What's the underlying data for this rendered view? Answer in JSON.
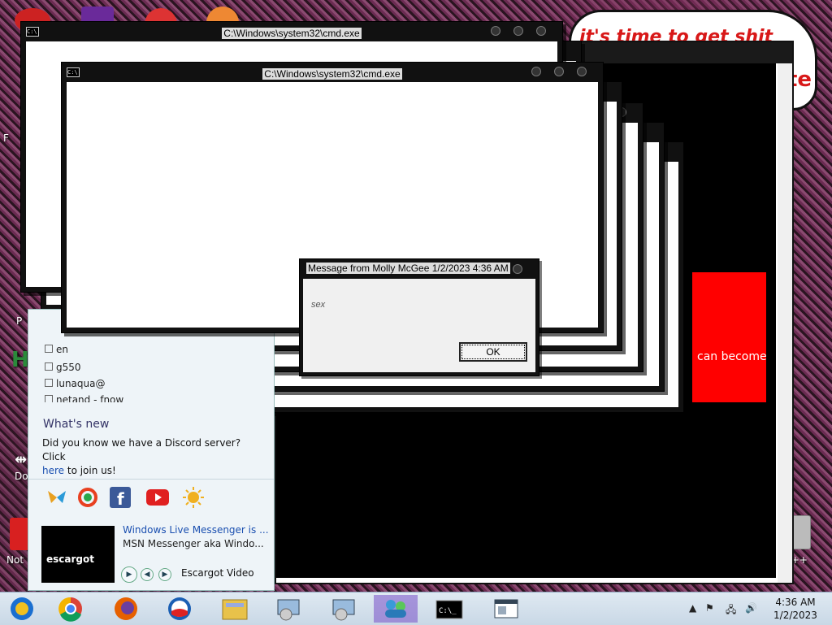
{
  "desktop": {
    "cloud_text_1": "it's time to get shit",
    "cloud_text_2": "te",
    "label_not": "Not",
    "label_do": "Do",
    "label_cpp": "n C++",
    "label_f": "F",
    "label_h": "H",
    "label_p": "P"
  },
  "red_banner": {
    "text": "can become"
  },
  "cmd_windows": {
    "title": "C:\\Windows\\system32\\cmd.exe",
    "icon_text": "C:\\"
  },
  "messenger": {
    "contacts": [
      "en",
      "g550",
      "lunaqua@",
      "netand - fnow"
    ],
    "whats_new": "What's new",
    "discord_text": "Did you know we have a Discord server? Click",
    "discord_link": "here",
    "discord_tail": " to join us!",
    "video_thumb_text": "escargot",
    "video_title": "Windows Live Messenger is ...",
    "video_desc": "MSN Messenger aka Windo...",
    "video_label": "Escargot Video",
    "social_icons": [
      "butterfly-icon",
      "escargot-icon",
      "facebook-icon",
      "youtube-icon",
      "weather-sun-icon"
    ]
  },
  "dialog": {
    "title": "Message from Molly McGee 1/2/2023 4:36 AM",
    "message": "sex",
    "ok_label": "OK"
  },
  "taskbar": {
    "apps": [
      "chrome-canary-icon",
      "chrome-icon",
      "firefox-icon",
      "obama-icon",
      "file-explorer-icon",
      "installer-icon",
      "installer-icon-2",
      "msn-messenger-icon",
      "cmd-icon",
      "window-icon"
    ],
    "time": "4:36 AM",
    "date": "1/2/2023",
    "colors": {
      "active": "#7a50c8"
    }
  }
}
